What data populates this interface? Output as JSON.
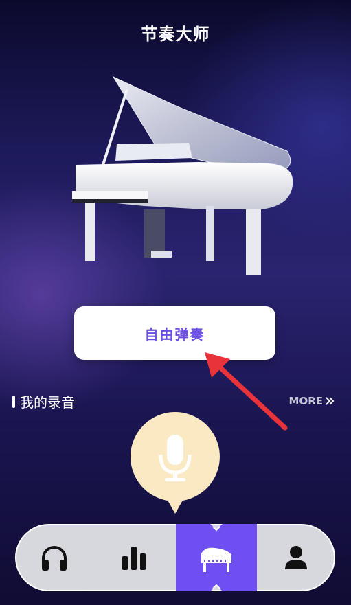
{
  "header": {
    "title": "节奏大师"
  },
  "main": {
    "free_play_label": "自由弹奏",
    "recordings_title": "我的录音",
    "more_label": "MORE"
  },
  "bottom_nav": {
    "items": [
      {
        "icon": "headphones-icon",
        "active": false
      },
      {
        "icon": "bar-chart-icon",
        "active": false
      },
      {
        "icon": "piano-icon",
        "active": true
      },
      {
        "icon": "user-icon",
        "active": false
      }
    ]
  },
  "colors": {
    "accent": "#6d4fe0",
    "active_tab": "#6f4ff2",
    "mic_bubble": "#fbe9c4",
    "arrow": "#e8333a"
  }
}
